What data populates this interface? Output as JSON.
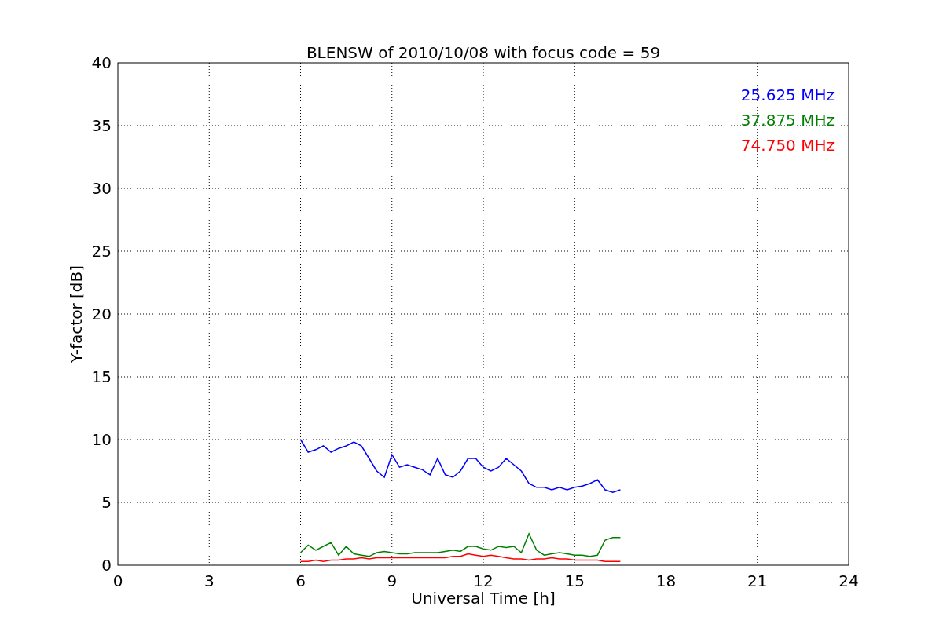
{
  "chart_data": {
    "type": "line",
    "title": "BLENSW of 2010/10/08 with focus code = 59",
    "xlabel": "Universal Time [h]",
    "ylabel": "Y-factor [dB]",
    "x": [
      6,
      6.25,
      6.5,
      6.75,
      7,
      7.25,
      7.5,
      7.75,
      8,
      8.25,
      8.5,
      8.75,
      9,
      9.25,
      9.5,
      9.75,
      10,
      10.25,
      10.5,
      10.75,
      11,
      11.25,
      11.5,
      11.75,
      12,
      12.25,
      12.5,
      12.75,
      13,
      13.25,
      13.5,
      13.75,
      14,
      14.25,
      14.5,
      14.75,
      15,
      15.25,
      15.5,
      15.75,
      16,
      16.25,
      16.5
    ],
    "series": [
      {
        "name": "25.625 MHz",
        "color": "#0000ff",
        "values": [
          10,
          9,
          9.2,
          9.5,
          9,
          9.3,
          9.5,
          9.8,
          9.5,
          8.5,
          7.5,
          7,
          8.8,
          7.8,
          8,
          7.8,
          7.6,
          7.2,
          8.5,
          7.2,
          7,
          7.5,
          8.5,
          8.5,
          7.8,
          7.5,
          7.8,
          8.5,
          8,
          7.5,
          6.5,
          6.2,
          6.2,
          6,
          6.2,
          6,
          6.2,
          6.3,
          6.5,
          6.8,
          6,
          5.8,
          6
        ]
      },
      {
        "name": "37.875 MHz",
        "color": "#008000",
        "values": [
          1,
          1.6,
          1.2,
          1.5,
          1.8,
          0.8,
          1.5,
          0.9,
          0.8,
          0.7,
          1,
          1.1,
          1,
          0.9,
          0.9,
          1,
          1,
          1,
          1,
          1.1,
          1.2,
          1.1,
          1.5,
          1.5,
          1.3,
          1.2,
          1.5,
          1.4,
          1.5,
          1,
          2.5,
          1.2,
          0.8,
          0.9,
          1,
          0.9,
          0.8,
          0.8,
          0.7,
          0.8,
          2,
          2.2,
          2.2
        ]
      },
      {
        "name": "74.750 MHz",
        "color": "#ff0000",
        "values": [
          0.3,
          0.3,
          0.4,
          0.3,
          0.4,
          0.4,
          0.5,
          0.5,
          0.6,
          0.5,
          0.6,
          0.6,
          0.6,
          0.6,
          0.6,
          0.6,
          0.6,
          0.6,
          0.6,
          0.6,
          0.7,
          0.7,
          0.9,
          0.8,
          0.7,
          0.8,
          0.7,
          0.6,
          0.5,
          0.5,
          0.4,
          0.5,
          0.5,
          0.6,
          0.5,
          0.5,
          0.4,
          0.4,
          0.4,
          0.4,
          0.3,
          0.3,
          0.3
        ]
      }
    ],
    "grid": true,
    "xlim": [
      0,
      24
    ],
    "ylim": [
      0,
      40
    ],
    "xticks": [
      0,
      3,
      6,
      9,
      12,
      15,
      18,
      21,
      24
    ],
    "yticks": [
      0,
      5,
      10,
      15,
      20,
      25,
      30,
      35,
      40
    ]
  }
}
